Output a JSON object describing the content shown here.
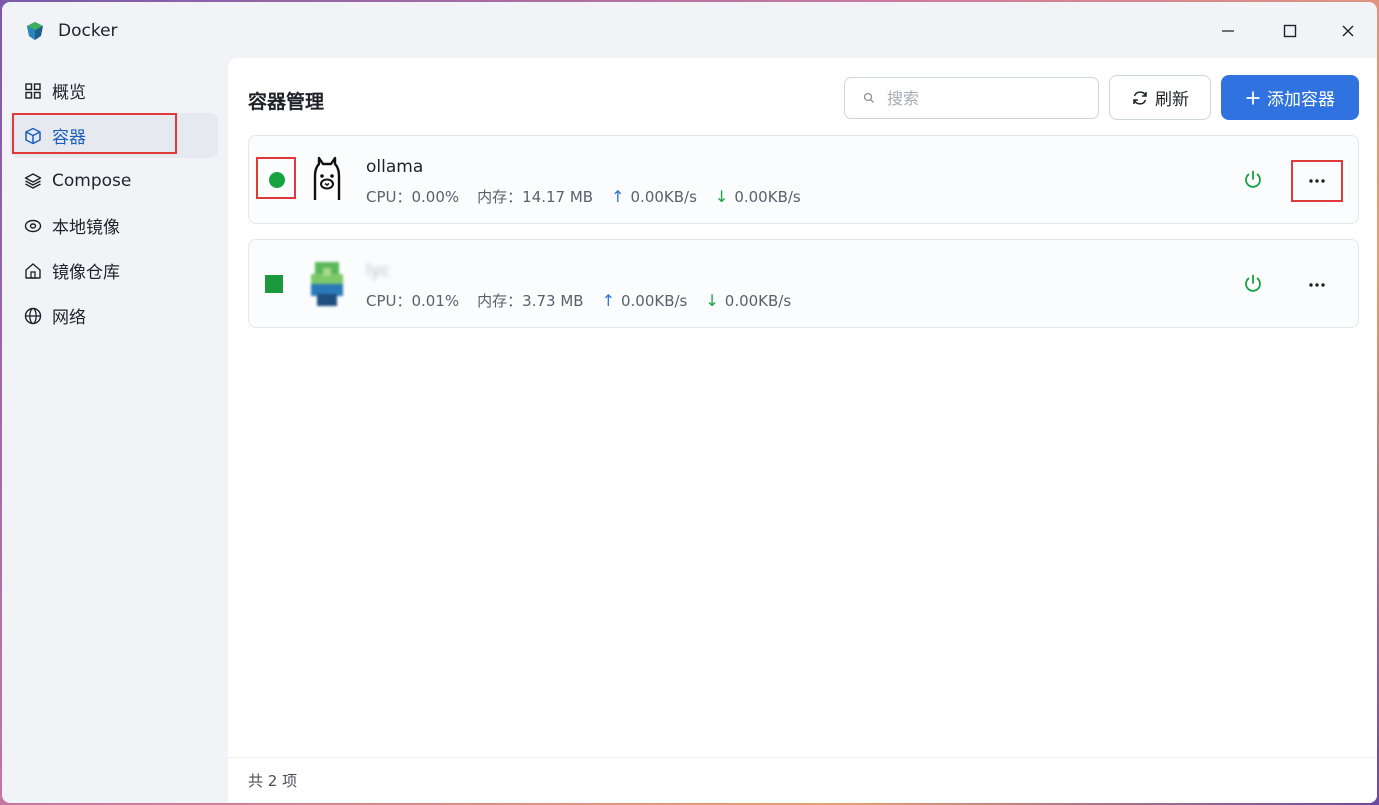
{
  "window": {
    "title": "Docker"
  },
  "sidebar": {
    "items": [
      {
        "label": "概览",
        "icon": "grid-icon"
      },
      {
        "label": "容器",
        "icon": "cube-icon",
        "active": true
      },
      {
        "label": "Compose",
        "icon": "layers-icon"
      },
      {
        "label": "本地镜像",
        "icon": "disk-icon"
      },
      {
        "label": "镜像仓库",
        "icon": "home-icon"
      },
      {
        "label": "网络",
        "icon": "globe-icon"
      }
    ]
  },
  "header": {
    "title": "容器管理",
    "search_placeholder": "搜索",
    "refresh_label": "刷新",
    "add_label": "添加容器"
  },
  "containers": [
    {
      "name": "ollama",
      "cpu": "CPU：0.00%",
      "memory": "内存：14.17 MB",
      "upload": "0.00KB/s",
      "download": "0.00KB/s",
      "status": "running"
    },
    {
      "name": "lyc",
      "cpu": "CPU：0.01%",
      "memory": "内存：3.73 MB",
      "upload": "0.00KB/s",
      "download": "0.00KB/s",
      "status": "running"
    }
  ],
  "footer": {
    "count_text": "共 2 项"
  },
  "colors": {
    "accent": "#2f72e0",
    "running": "#17a340",
    "highlight": "#e03a3a"
  }
}
